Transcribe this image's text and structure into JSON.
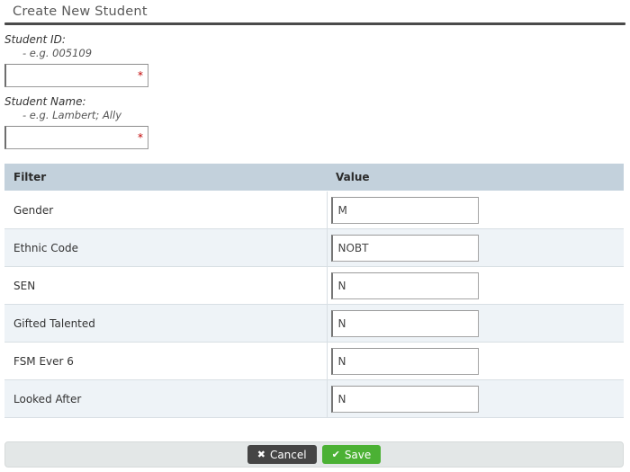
{
  "page": {
    "title": "Create New Student"
  },
  "required_fields": [
    {
      "label": "Student ID:",
      "hint": "- e.g. 005109",
      "value": "",
      "placeholder": "",
      "required_marker": "*"
    },
    {
      "label": "Student Name:",
      "hint": "- e.g. Lambert; Ally",
      "value": "",
      "placeholder": "",
      "required_marker": "*"
    }
  ],
  "filter_table": {
    "columns": [
      "Filter",
      "Value"
    ],
    "rows": [
      {
        "filter": "Gender",
        "value": "M"
      },
      {
        "filter": "Ethnic Code",
        "value": "NOBT"
      },
      {
        "filter": "SEN",
        "value": "N"
      },
      {
        "filter": "Gifted Talented",
        "value": "N"
      },
      {
        "filter": "FSM Ever 6",
        "value": "N"
      },
      {
        "filter": "Looked After",
        "value": "N"
      }
    ]
  },
  "actions": {
    "cancel": {
      "label": "Cancel",
      "glyph": "✖"
    },
    "save": {
      "label": "Save",
      "glyph": "✔"
    }
  },
  "colors": {
    "table_header_bg": "#c3d1dc",
    "row_alt_bg": "#eef3f7",
    "required_star": "#c00000",
    "save_green": "#4bb134",
    "cancel_dark": "#454545",
    "footer_bg": "#e3e7e7"
  }
}
